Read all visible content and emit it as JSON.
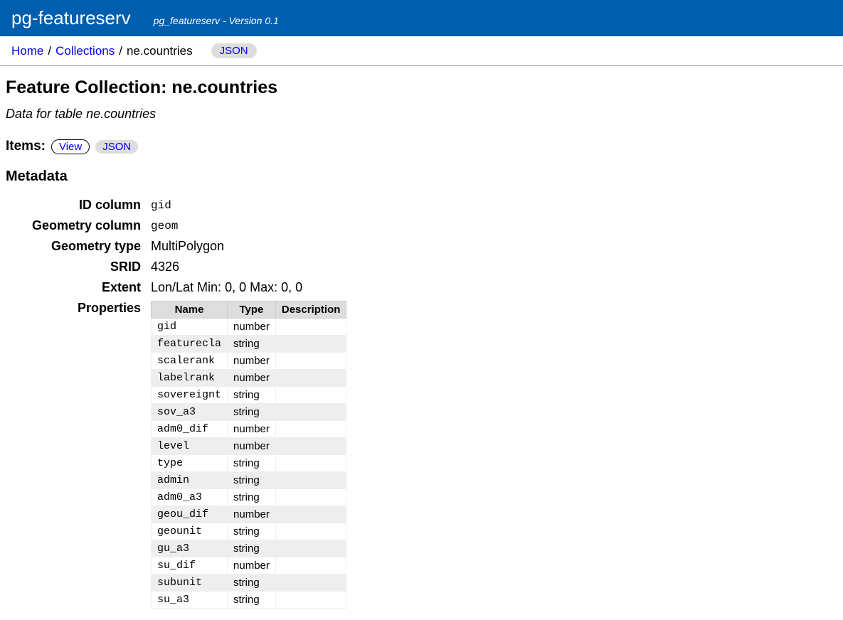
{
  "header": {
    "title": "pg-featureserv",
    "subtitle": "pg_featureserv - Version 0.1"
  },
  "breadcrumb": {
    "home": "Home",
    "collections": "Collections",
    "current": "ne.countries",
    "json_btn": "JSON"
  },
  "page": {
    "title": "Feature Collection: ne.countries",
    "description": "Data for table ne.countries"
  },
  "items": {
    "label": "Items:",
    "view_btn": "View",
    "json_btn": "JSON"
  },
  "metadata": {
    "heading": "Metadata",
    "labels": {
      "id_column": "ID column",
      "geometry_column": "Geometry column",
      "geometry_type": "Geometry type",
      "srid": "SRID",
      "extent": "Extent",
      "properties": "Properties"
    },
    "values": {
      "id_column": "gid",
      "geometry_column": "geom",
      "geometry_type": "MultiPolygon",
      "srid": "4326",
      "extent": "Lon/Lat Min: 0, 0 Max: 0, 0"
    },
    "props_header": {
      "name": "Name",
      "type": "Type",
      "description": "Description"
    },
    "properties": [
      {
        "name": "gid",
        "type": "number",
        "desc": ""
      },
      {
        "name": "featurecla",
        "type": "string",
        "desc": ""
      },
      {
        "name": "scalerank",
        "type": "number",
        "desc": ""
      },
      {
        "name": "labelrank",
        "type": "number",
        "desc": ""
      },
      {
        "name": "sovereignt",
        "type": "string",
        "desc": ""
      },
      {
        "name": "sov_a3",
        "type": "string",
        "desc": ""
      },
      {
        "name": "adm0_dif",
        "type": "number",
        "desc": ""
      },
      {
        "name": "level",
        "type": "number",
        "desc": ""
      },
      {
        "name": "type",
        "type": "string",
        "desc": ""
      },
      {
        "name": "admin",
        "type": "string",
        "desc": ""
      },
      {
        "name": "adm0_a3",
        "type": "string",
        "desc": ""
      },
      {
        "name": "geou_dif",
        "type": "number",
        "desc": ""
      },
      {
        "name": "geounit",
        "type": "string",
        "desc": ""
      },
      {
        "name": "gu_a3",
        "type": "string",
        "desc": ""
      },
      {
        "name": "su_dif",
        "type": "number",
        "desc": ""
      },
      {
        "name": "subunit",
        "type": "string",
        "desc": ""
      },
      {
        "name": "su_a3",
        "type": "string",
        "desc": ""
      }
    ]
  }
}
